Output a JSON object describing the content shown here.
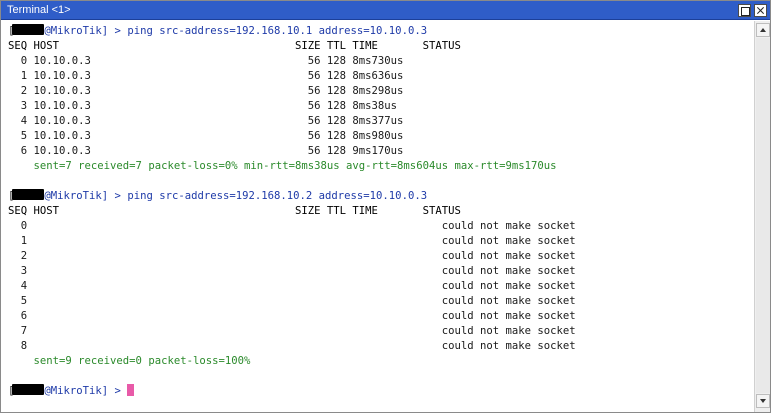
{
  "window": {
    "title": "Terminal <1>"
  },
  "session1": {
    "prompt_host": "@MikroTik] > ",
    "prompt_bracket": "[",
    "command": "ping src-address=192.168.10.1 address=10.10.0.3",
    "header": "SEQ HOST                                     SIZE TTL TIME       STATUS",
    "rows": [
      "  0 10.10.0.3                                  56 128 8ms730us",
      "  1 10.10.0.3                                  56 128 8ms636us",
      "  2 10.10.0.3                                  56 128 8ms298us",
      "  3 10.10.0.3                                  56 128 8ms38us",
      "  4 10.10.0.3                                  56 128 8ms377us",
      "  5 10.10.0.3                                  56 128 8ms980us",
      "  6 10.10.0.3                                  56 128 9ms170us"
    ],
    "summary": "    sent=7 received=7 packet-loss=0% min-rtt=8ms38us avg-rtt=8ms604us max-rtt=9ms170us"
  },
  "session2": {
    "prompt_host": "@MikroTik] > ",
    "prompt_bracket": "[",
    "command": "ping src-address=192.168.10.2 address=10.10.0.3",
    "header": "SEQ HOST                                     SIZE TTL TIME       STATUS",
    "rows": [
      "  0                                                                 could not make socket",
      "  1                                                                 could not make socket",
      "  2                                                                 could not make socket",
      "  3                                                                 could not make socket",
      "  4                                                                 could not make socket",
      "  5                                                                 could not make socket",
      "  6                                                                 could not make socket",
      "  7                                                                 could not make socket",
      "  8                                                                 could not make socket"
    ],
    "summary": "    sent=9 received=0 packet-loss=100%"
  },
  "final_prompt": {
    "prompt_bracket": "[",
    "prompt_host": "@MikroTik] > "
  },
  "colors": {
    "titlebar": "#2f5dc8",
    "prompt": "#1e3aa8",
    "summary": "#2b8a2b",
    "cursor": "#e85aa8"
  }
}
